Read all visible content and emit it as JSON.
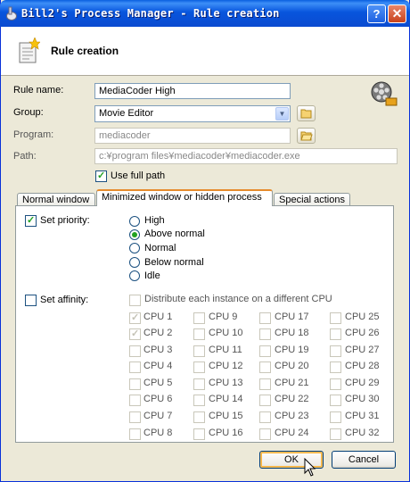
{
  "window": {
    "title": "Bill2's Process Manager - Rule creation",
    "help_label": "?",
    "close_label": "✕"
  },
  "header": {
    "title": "Rule creation"
  },
  "form": {
    "rule_name_label": "Rule name:",
    "rule_name_value": "MediaCoder High",
    "group_label": "Group:",
    "group_value": "Movie Editor",
    "program_label": "Program:",
    "program_value": "mediacoder",
    "path_label": "Path:",
    "path_value": "c:¥program files¥mediacoder¥mediacoder.exe",
    "use_full_path_label": "Use full path",
    "use_full_path_checked": true
  },
  "tabs": [
    {
      "label": "Normal window",
      "active": false
    },
    {
      "label": "Minimized window or hidden process",
      "active": true
    },
    {
      "label": "Special actions",
      "active": false
    }
  ],
  "priority": {
    "label": "Set priority:",
    "checked": true,
    "options": [
      "High",
      "Above normal",
      "Normal",
      "Below normal",
      "Idle"
    ],
    "selected": "Above normal"
  },
  "affinity": {
    "label": "Set affinity:",
    "checked": false,
    "distribute_label": "Distribute each instance on a different CPU",
    "cpus": [
      [
        "CPU 1",
        "CPU 2",
        "CPU 3",
        "CPU 4",
        "CPU 5",
        "CPU 6",
        "CPU 7",
        "CPU 8"
      ],
      [
        "CPU 9",
        "CPU 10",
        "CPU 11",
        "CPU 12",
        "CPU 13",
        "CPU 14",
        "CPU 15",
        "CPU 16"
      ],
      [
        "CPU 17",
        "CPU 18",
        "CPU 19",
        "CPU 20",
        "CPU 21",
        "CPU 22",
        "CPU 23",
        "CPU 24"
      ],
      [
        "CPU 25",
        "CPU 26",
        "CPU 27",
        "CPU 28",
        "CPU 29",
        "CPU 30",
        "CPU 31",
        "CPU 32"
      ]
    ],
    "checked_cpus": [
      "CPU 1",
      "CPU 2"
    ]
  },
  "buttons": {
    "ok_label": "OK",
    "cancel_label": "Cancel"
  }
}
